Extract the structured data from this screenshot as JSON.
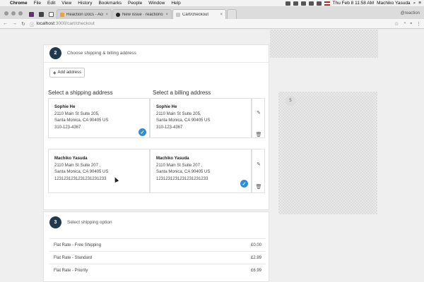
{
  "menubar": {
    "app": "Chrome",
    "items": [
      "File",
      "Edit",
      "View",
      "History",
      "Bookmarks",
      "People",
      "Window",
      "Help"
    ],
    "clock": "Thu Feb 8 11:58 AM",
    "user": "Machiko Yasuda"
  },
  "tabs": [
    {
      "title": "Reaction Docs - Acceptance",
      "active": false,
      "color": "#e8a33c"
    },
    {
      "title": "New issue · reactioncommerce",
      "active": false,
      "color": "#222222"
    },
    {
      "title": "Cart/checkout",
      "active": true,
      "color": "#c9c9c9"
    }
  ],
  "profile": "@reaction",
  "address_bar": {
    "host": "localhost",
    "path": ":3000/cart/checkout"
  },
  "step2": {
    "number": "2",
    "title": "Choose shipping & billing address",
    "add_address": "Add address",
    "shipping_heading": "Select a shipping address",
    "billing_heading": "Select a billing address",
    "addresses": [
      {
        "name": "Sophie He",
        "line1": "2110 Main St Suite 205,",
        "line2": "Santa Monica, CA 90405 US",
        "phone": "310-123-4367",
        "shipping_selected": true,
        "billing_selected": false
      },
      {
        "name": "Machiko Yasuda",
        "line1": "2110 Main St Suite 207 ,",
        "line2": "Santa Monica, CA 90405 US",
        "phone": "1231231231231231231233",
        "shipping_selected": false,
        "billing_selected": true
      }
    ]
  },
  "step3": {
    "number": "3",
    "title": "Select shipping option",
    "options": [
      {
        "label": "Flat Rate - Free Shipping",
        "price": "£0.00"
      },
      {
        "label": "Flat Rate - Standard",
        "price": "£2.99"
      },
      {
        "label": "Flat Rate - Priority",
        "price": "£6.99"
      }
    ]
  },
  "sidebar_step": {
    "number": "5"
  },
  "colors": {
    "step_badge": "#1e3a4c",
    "check": "#2d8fd6"
  }
}
